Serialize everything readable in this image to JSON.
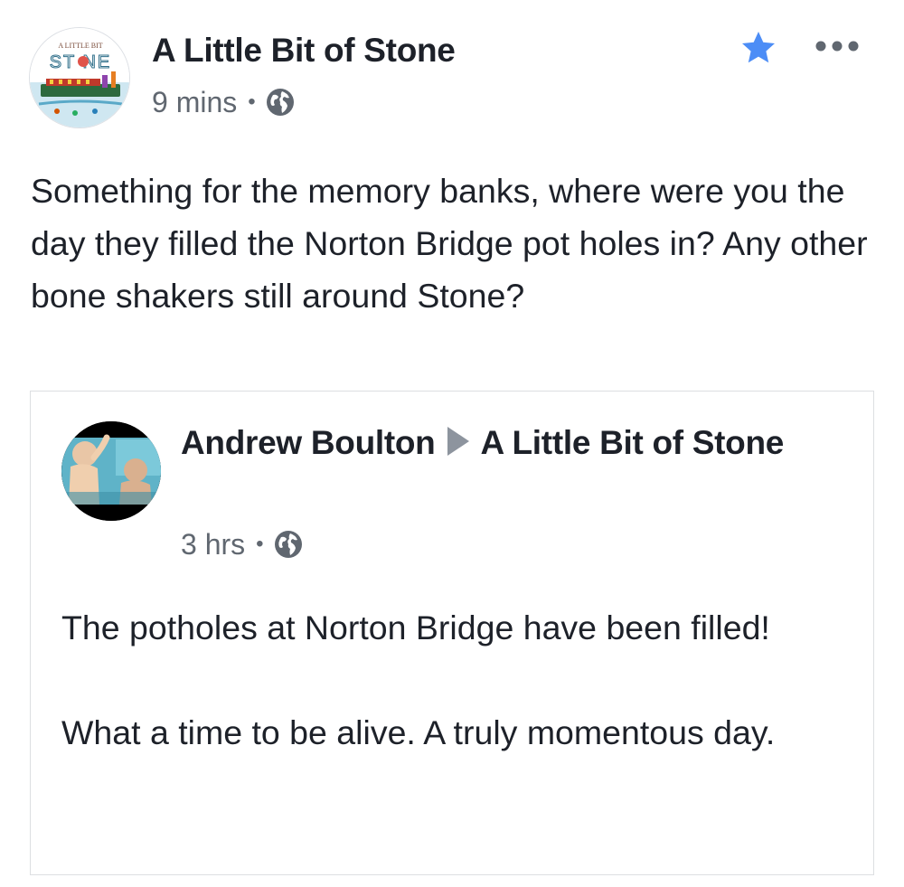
{
  "post": {
    "page_name": "A Little Bit of Stone",
    "avatar_text_top": "A LITTLE BIT",
    "avatar_text_main": "ST NE",
    "time": "9 mins",
    "separator": "•",
    "privacy_icon": "globe-icon",
    "star_icon": "star-icon",
    "more_icon": "more-options-icon",
    "caption": "Something for the memory banks, where were you the day they filled the Norton Bridge pot holes in? Any other bone shakers still around Stone?"
  },
  "shared": {
    "author": "Andrew Boulton",
    "target": "A Little Bit of Stone",
    "time": "3 hrs",
    "separator": "•",
    "paragraph_1": "The potholes at Norton Bridge have been filled!",
    "paragraph_2": "What a time to be alive. A truly momentous day."
  },
  "colors": {
    "text_primary": "#1d2129",
    "text_secondary": "#606770",
    "star_blue": "#4c8df6",
    "border": "#dddfe2",
    "arrow_gray": "#8d949e"
  }
}
